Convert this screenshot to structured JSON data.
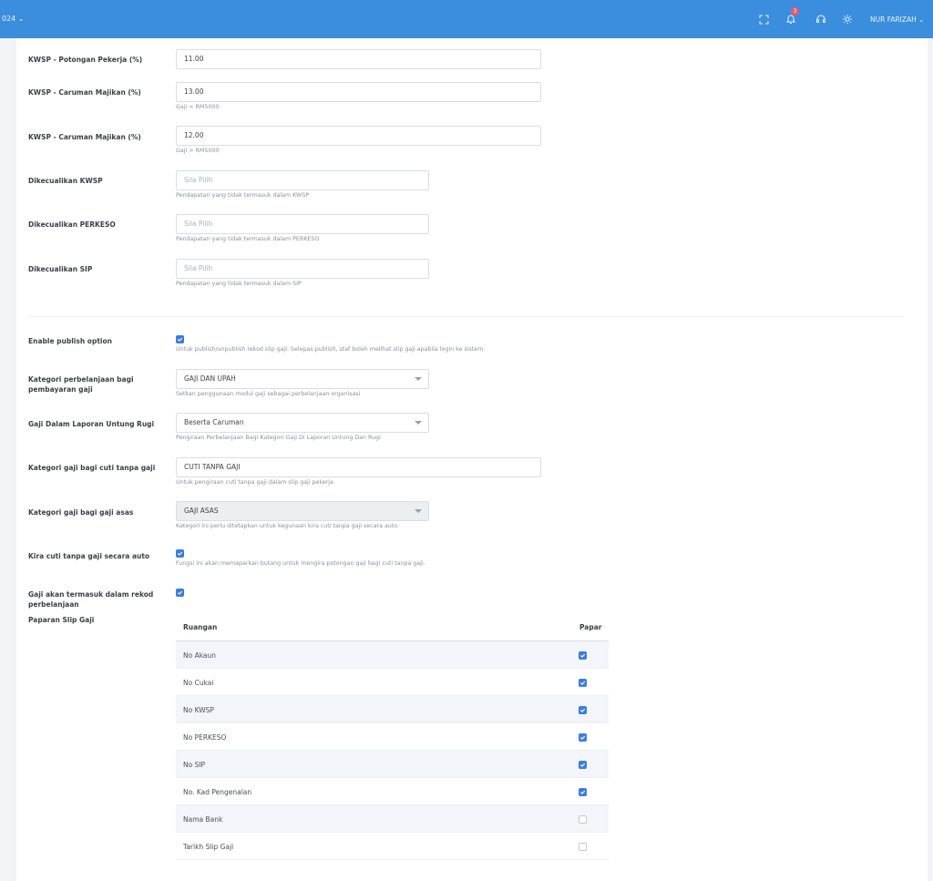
{
  "topbar": {
    "year_fragment": "024 ⌄",
    "notification_count": "3",
    "user_name": "NUR FARIZAH ⌄"
  },
  "form": {
    "kwsp_pekerja": {
      "label": "KWSP - Potongan Pekerja (%)",
      "value": "11.00"
    },
    "kwsp_majikan_lt": {
      "label": "KWSP - Caruman Majikan (%)",
      "value": "13.00",
      "help": "Gaji < RM5000"
    },
    "kwsp_majikan_gt": {
      "label": "KWSP - Caruman Majikan (%)",
      "value": "12.00",
      "help": "Gaji > RM5000"
    },
    "exc_kwsp": {
      "label": "Dikecualikan KWSP",
      "placeholder": "Sila Pilih",
      "help": "Pendapatan yang tidak termasuk dalam KWSP"
    },
    "exc_perkeso": {
      "label": "Dikecualikan PERKESO",
      "placeholder": "Sila Pilih",
      "help": "Pendapatan yang tidak termasuk dalam PERKESO"
    },
    "exc_sip": {
      "label": "Dikecualikan SIP",
      "placeholder": "Sila Pilih",
      "help": "Pendapatan yang tidak termasuk dalam SIP"
    },
    "publish": {
      "label": "Enable publish option",
      "checked": true,
      "help": "Untuk publish/unpublish rekod slip gaji. Selepas publish, staf boleh melihat slip gaji apabila login ke sistem."
    },
    "kategori_belanja": {
      "label": "Kategori perbelanjaan bagi pembayaran gaji",
      "value": "GAJI DAN UPAH",
      "help": "Setkan penggunaan modul gaji sebagai perbelanjaan organisasi"
    },
    "untung_rugi": {
      "label": "Gaji Dalam Laporan Untung Rugi",
      "value": "Beserta Caruman",
      "help": "Pengiraan Perbelanjaan Bagi Kategori Gaji Di Laporan Untung Dan Rugi"
    },
    "cuti_tanpa_gaji": {
      "label": "Kategori gaji bagi cuti tanpa gaji",
      "value": "CUTI TANPA GAJI",
      "help": "Untuk pengiraan cuti tanpa gaji dalam slip gaji pekerja"
    },
    "gaji_asas": {
      "label": "Kategori gaji bagi gaji asas",
      "value": "GAJI ASAS",
      "help": "Kategori ini perlu ditetapkan untuk kegunaan kira cuti tanpa gaji secara auto."
    },
    "kira_auto": {
      "label": "Kira cuti tanpa gaji secara auto",
      "checked": true,
      "help": "Fungsi ini akan memaparkan butang untuk mengira potongan gaji bagi cuti tanpa gaji."
    },
    "rekod_belanja": {
      "label": "Gaji akan termasuk dalam rekod perbelanjaan",
      "checked": true
    },
    "paparan": {
      "label": "Paparan Slip Gaji"
    }
  },
  "table": {
    "headers": [
      "Ruangan",
      "Papar"
    ],
    "rows": [
      {
        "name": "No Akaun",
        "checked": true
      },
      {
        "name": "No Cukai",
        "checked": true
      },
      {
        "name": "No KWSP",
        "checked": true
      },
      {
        "name": "No PERKESO",
        "checked": true
      },
      {
        "name": "No SIP",
        "checked": true
      },
      {
        "name": "No. Kad Pengenalan",
        "checked": true
      },
      {
        "name": "Nama Bank",
        "checked": false
      },
      {
        "name": "Tarikh Slip Gaji",
        "checked": false
      }
    ]
  },
  "colors": {
    "topbar": "#3b8ede",
    "checkbox": "#3b7ddd",
    "badge": "#f1556c"
  }
}
